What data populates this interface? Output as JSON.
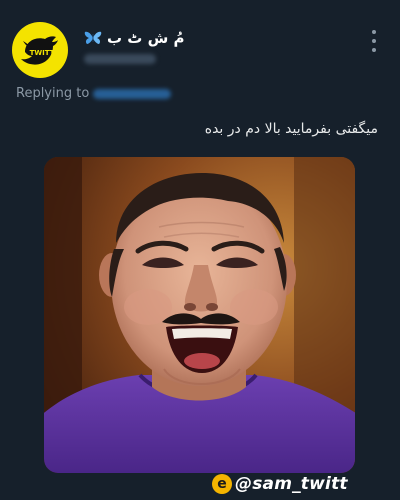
{
  "author": {
    "display_name": "مُ ش ٹ ب",
    "avatar_label": "TWITT",
    "avatar_icon": "twitter-bird-icon",
    "badge_icon": "butterfly-icon"
  },
  "reply": {
    "prefix": "Replying to"
  },
  "tweet": {
    "text": "میگفتی بفرمایید بالا دم در بده"
  },
  "watermark": {
    "icon_letter": "e",
    "handle": "@sam_twitt"
  },
  "colors": {
    "background": "#16202b",
    "avatar_yellow": "#f4e300",
    "secondary_text": "#8b98a5",
    "link_blue": "#1d9bf0",
    "butterfly_blue": "#4a9fe8"
  }
}
